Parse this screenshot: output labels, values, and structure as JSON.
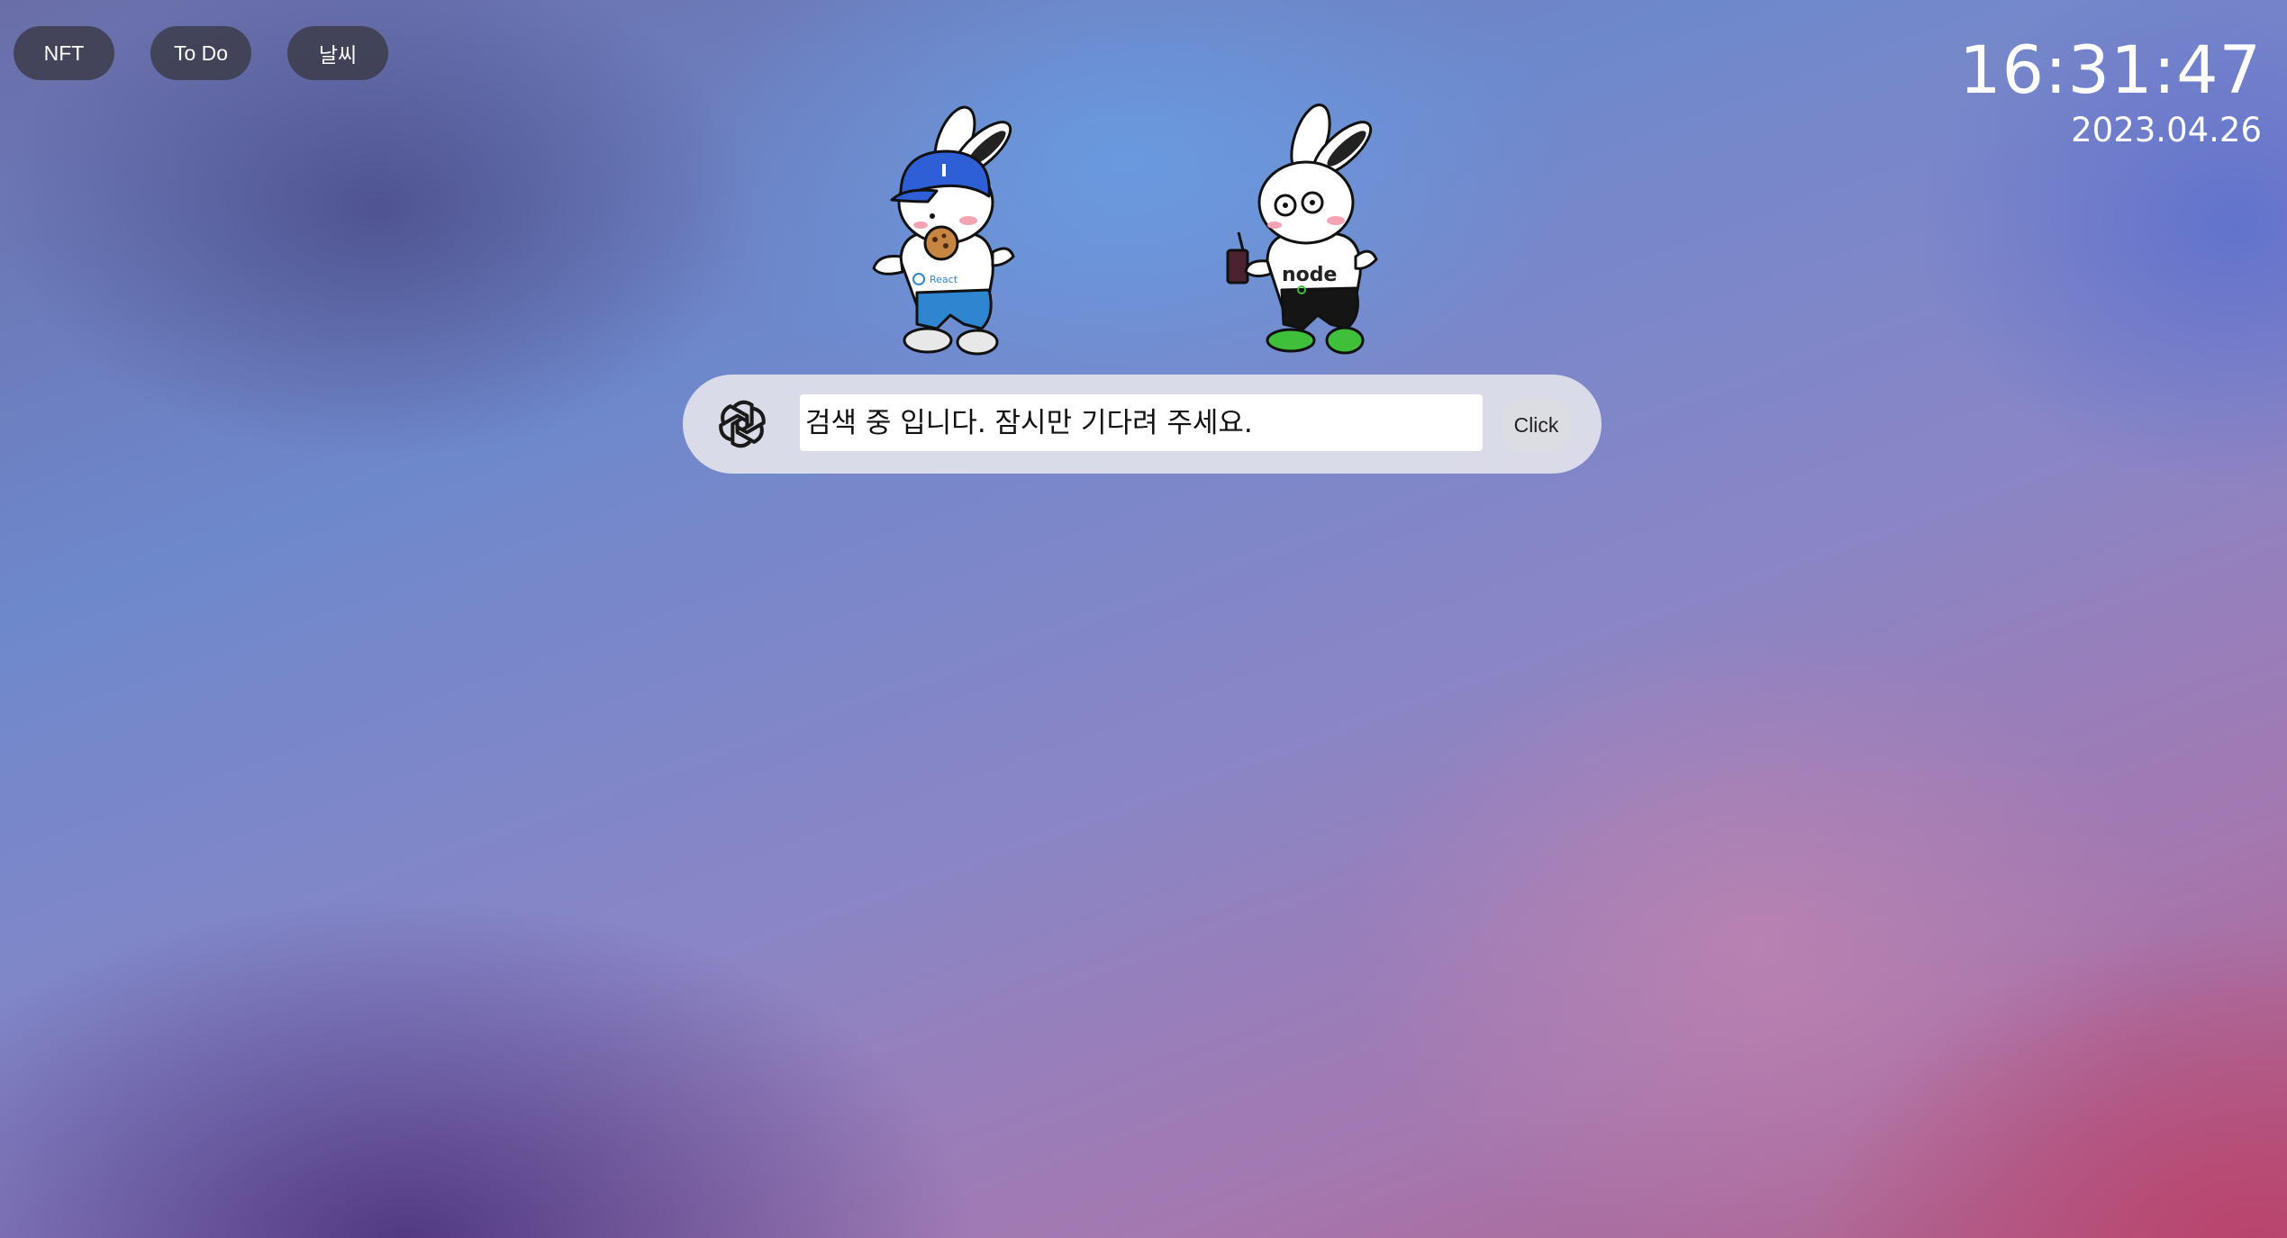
{
  "nav": {
    "items": [
      {
        "label": "NFT"
      },
      {
        "label": "To Do"
      },
      {
        "label": "날씨"
      }
    ]
  },
  "clock": {
    "time": "16:31:47",
    "date": "2023.04.26"
  },
  "mascots": [
    {
      "name": "react-bunny",
      "shirt_text": "React"
    },
    {
      "name": "node-bunny",
      "shirt_text": "node"
    }
  ],
  "search": {
    "icon": "openai-logo-icon",
    "placeholder": "검색 중 입니다. 잠시만 기다려 주세요.",
    "value": "",
    "button_label": "Click"
  },
  "colors": {
    "nav_button_bg": "#3a3a48",
    "search_pill_bg": "#e2e2ea",
    "react_cap": "#2f5fd6",
    "react_pants": "#2f86d0",
    "node_shoes": "#3fbf3a"
  }
}
